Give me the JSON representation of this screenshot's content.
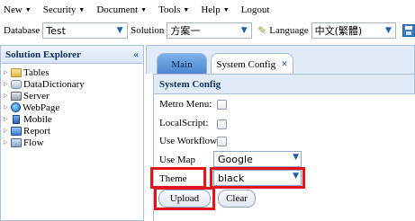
{
  "menu": {
    "items": [
      {
        "label": "New",
        "dropdown": true
      },
      {
        "label": "Security",
        "dropdown": true
      },
      {
        "label": "Document",
        "dropdown": true
      },
      {
        "label": "Tools",
        "dropdown": true
      },
      {
        "label": "Help",
        "dropdown": true
      },
      {
        "label": "Logout",
        "dropdown": false
      }
    ]
  },
  "toolbar": {
    "database_label": "Database",
    "database_value": "Test",
    "solution_label": "Solution",
    "solution_value": "方案一",
    "language_label": "Language",
    "language_value": "中文(繁體)"
  },
  "explorer": {
    "title": "Solution Explorer",
    "items": [
      {
        "label": "Tables",
        "icon": "folder-icon"
      },
      {
        "label": "DataDictionary",
        "icon": "database-icon"
      },
      {
        "label": "Server",
        "icon": "server-icon"
      },
      {
        "label": "WebPage",
        "icon": "globe-icon"
      },
      {
        "label": "Mobile",
        "icon": "mobile-icon"
      },
      {
        "label": "Report",
        "icon": "report-icon"
      },
      {
        "label": "Flow",
        "icon": "flow-icon"
      }
    ]
  },
  "tabs": [
    {
      "label": "Main",
      "active": false
    },
    {
      "label": "System Config",
      "active": true,
      "closable": true
    }
  ],
  "config": {
    "title": "System Config",
    "metro_menu_label": "Metro Menu:",
    "metro_menu_checked": false,
    "local_script_label": "LocalScript:",
    "local_script_checked": false,
    "use_workflow_label": "Use Workflow",
    "use_workflow_checked": false,
    "use_map_label": "Use Map",
    "use_map_value": "Google",
    "theme_label": "Theme",
    "theme_value": "black",
    "upload_label": "Upload",
    "clear_label": "Clear"
  },
  "colors": {
    "highlight": "#e3121b",
    "accent": "#1f5fa8",
    "panel_header": "#e1ebf7"
  }
}
